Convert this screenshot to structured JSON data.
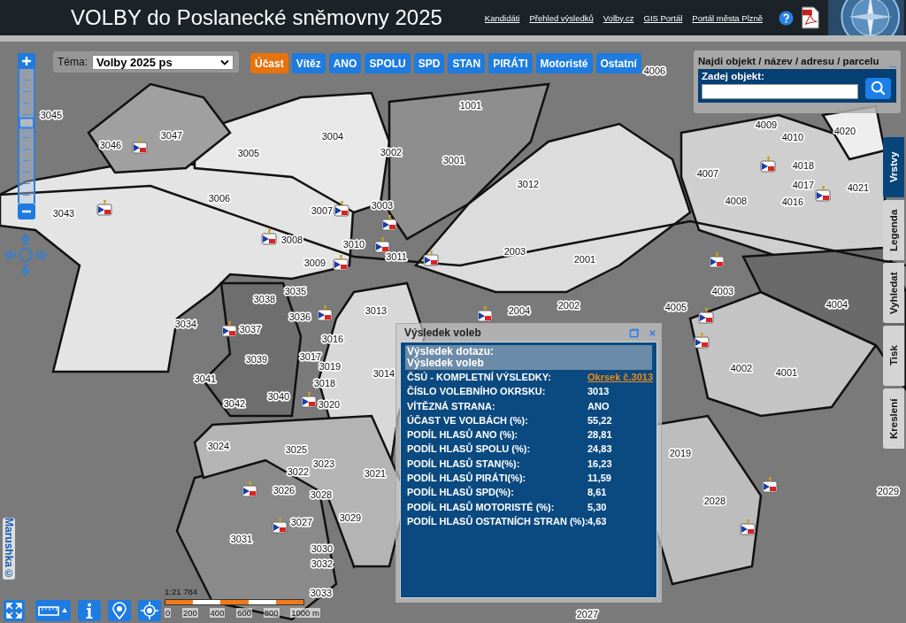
{
  "header": {
    "title": "VOLBY do Poslanecké sněmovny 2025",
    "links": [
      "Kandidáti",
      "Přehled výsledků",
      "Volby.cz",
      "GIS Portál",
      "Portál města Plzně"
    ]
  },
  "theme": {
    "label": "Téma:",
    "value": "Volby 2025 ps"
  },
  "layer_buttons": [
    {
      "label": "Účast",
      "selected": true
    },
    {
      "label": "Vítěz",
      "selected": false
    },
    {
      "label": "ANO",
      "selected": false
    },
    {
      "label": "SPOLU",
      "selected": false
    },
    {
      "label": "SPD",
      "selected": false
    },
    {
      "label": "STAN",
      "selected": false
    },
    {
      "label": "PIRÁTI",
      "selected": false
    },
    {
      "label": "Motoristé",
      "selected": false
    },
    {
      "label": "Ostatní",
      "selected": false
    }
  ],
  "search": {
    "title": "Najdi objekt / název / adresu / parcelu",
    "minimize": "_",
    "label": "Zadej objekt:"
  },
  "side_tabs": [
    {
      "label": "Vrstvy",
      "selected": true
    },
    {
      "label": "Legenda",
      "selected": false
    },
    {
      "label": "Vyhledat",
      "selected": false
    },
    {
      "label": "Tisk",
      "selected": false
    },
    {
      "label": "Kreslení",
      "selected": false
    }
  ],
  "zoom": {
    "level": 0.6
  },
  "map": {
    "district_labels": [
      "4006",
      "1001",
      "4009",
      "4010",
      "4020",
      "3045",
      "3046",
      "3047",
      "3004",
      "3005",
      "3002",
      "3001",
      "3012",
      "4018",
      "4007",
      "4017",
      "4021",
      "4008",
      "4016",
      "3006",
      "3043",
      "3003",
      "3007",
      "3008",
      "3010",
      "3011",
      "3009",
      "2003",
      "2001",
      "4003",
      "4005",
      "4004",
      "3035",
      "3038",
      "2002",
      "3013",
      "2004",
      "3036",
      "3034",
      "3016",
      "3037",
      "3039",
      "3017",
      "3019",
      "3014",
      "4002",
      "4001",
      "3041",
      "3018",
      "3042",
      "3040",
      "3020",
      "3024",
      "3025",
      "3023",
      "3022",
      "3021",
      "2019",
      "3026",
      "3028",
      "2029",
      "2028",
      "3029",
      "3031",
      "3027",
      "3030",
      "3032",
      "3033",
      "2027"
    ],
    "attribution": "Marushka©"
  },
  "popup": {
    "title": "Výsledek voleb",
    "query_header": [
      "Výsledek dotazu:",
      "Výsledek voleb"
    ],
    "rows": [
      {
        "label": "ČSÚ - KOMPLETNÍ VÝSLEDKY:",
        "value": "Okrsek č.3013",
        "kind": "link"
      },
      {
        "label": "ČÍSLO VOLEBNÍHO OKRSKU:",
        "value": "3013",
        "kind": "text"
      },
      {
        "label": "VÍTĚZNÁ STRANA:",
        "value": "ANO",
        "kind": "text"
      },
      {
        "label": "ÚČAST VE VOLBÁCH (%):",
        "value": "55,22",
        "kind": "text"
      },
      {
        "label": "PODÍL HLASŮ ANO (%):",
        "value": "28,81",
        "kind": "text"
      },
      {
        "label": "PODÍL HLASŮ SPOLU (%):",
        "value": "24,83",
        "kind": "text"
      },
      {
        "label": "PODÍL HLASŮ STAN(%):",
        "value": "16,23",
        "kind": "text"
      },
      {
        "label": "PODÍL HLASŮ PIRÁTI(%):",
        "value": "11,59",
        "kind": "text"
      },
      {
        "label": "PODÍL HLASŮ SPD(%):",
        "value": "8,61",
        "kind": "text"
      },
      {
        "label": "PODÍL HLASŮ MOTORISTÉ (%):",
        "value": "5,30",
        "kind": "text"
      },
      {
        "label": "PODÍL HLASŮ OSTATNÍCH STRAN (%):",
        "value": "4,63",
        "kind": "text"
      }
    ]
  },
  "scale": {
    "ratio": "1:21 784",
    "ticks": [
      "0",
      "200",
      "400",
      "600",
      "800",
      "1000 m"
    ]
  }
}
